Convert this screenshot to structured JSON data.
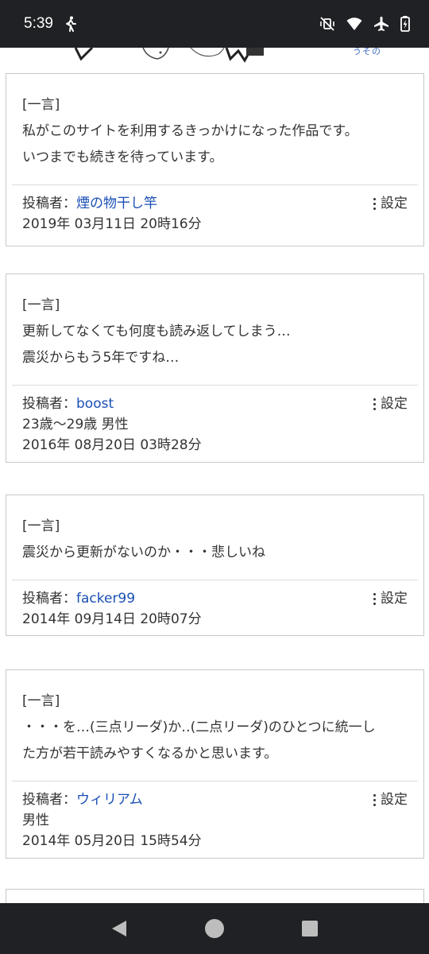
{
  "status_bar": {
    "time": "5:39",
    "icons": [
      "walking-icon",
      "vibrate-off-icon",
      "wifi-icon",
      "airplane-icon",
      "battery-charging-icon"
    ]
  },
  "banner": {
    "partial_text": "うその"
  },
  "comments": [
    {
      "label": "[一言]",
      "lines": [
        "私がこのサイトを利用するきっかけになった作品です。",
        "いつまでも続きを待っています。"
      ],
      "author_prefix": "投稿者：",
      "author": "煙の物干し竿",
      "author_info": "",
      "date": "2019年 03月11日 20時16分",
      "settings_label": "設定"
    },
    {
      "label": "[一言]",
      "lines": [
        "更新してなくても何度も読み返してしまう…",
        "震災からもう5年ですね…"
      ],
      "author_prefix": "投稿者：",
      "author": "boost",
      "author_info": "23歳～29歳 男性",
      "date": "2016年 08月20日 03時28分",
      "settings_label": "設定"
    },
    {
      "label": "[一言]",
      "lines": [
        "震災から更新がないのか・・・悲しいね"
      ],
      "author_prefix": "投稿者：",
      "author": "facker99",
      "author_info": "",
      "date": "2014年 09月14日 20時07分",
      "settings_label": "設定"
    },
    {
      "label": "[一言]",
      "lines": [
        "・・・を…(三点リーダ)か‥(二点リーダ)のひとつに統一し",
        "た方が若干読みやすくなるかと思います。"
      ],
      "author_prefix": "投稿者：",
      "author": "ウィリアム",
      "author_info": "男性",
      "date": "2014年 05月20日 15時54分",
      "settings_label": "設定"
    }
  ],
  "nav_bar": {
    "buttons": [
      "back-icon",
      "home-icon",
      "recents-icon"
    ]
  },
  "colors": {
    "status_bar": "#202124",
    "link": "#1a4fb5",
    "border": "#c8c8c8"
  }
}
